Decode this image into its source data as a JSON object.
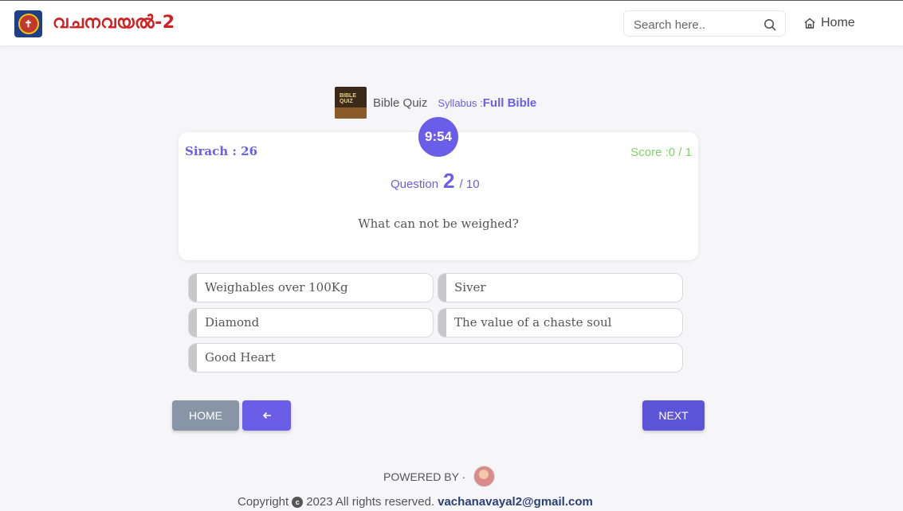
{
  "header": {
    "brand": "വചനവയൽ-2",
    "search_placeholder": "Search here..",
    "home_label": "Home"
  },
  "quiz": {
    "title": "Bible Quiz",
    "syllabus_label": "Syllabus :",
    "syllabus_value": "Full Bible",
    "thumb_text": "BIBLE QUIZ",
    "timer": "9:54",
    "chapter": "Sirach : 26",
    "score": "Score :0 / 1",
    "question_label": "Question",
    "question_number": "2",
    "question_total": "/ 10",
    "question_text": "What can not be weighed?",
    "options": [
      "Weighables over 100Kg",
      "Siver",
      "Diamond",
      "The value of a chaste soul",
      "Good Heart"
    ]
  },
  "buttons": {
    "home": "HOME",
    "back_icon": "arrow-left-icon",
    "next": "NEXT"
  },
  "footer": {
    "powered_by": "POWERED BY ·",
    "copyright_prefix": "Copyright",
    "copyright_symbol": "c",
    "copyright_text": "2023 All rights reserved.",
    "email": "vachanavayal2@gmail.com"
  },
  "colors": {
    "accent": "#6a5ee8",
    "score": "#7fd36b",
    "brand": "#d21f1f",
    "home_button": "#8795a7"
  }
}
